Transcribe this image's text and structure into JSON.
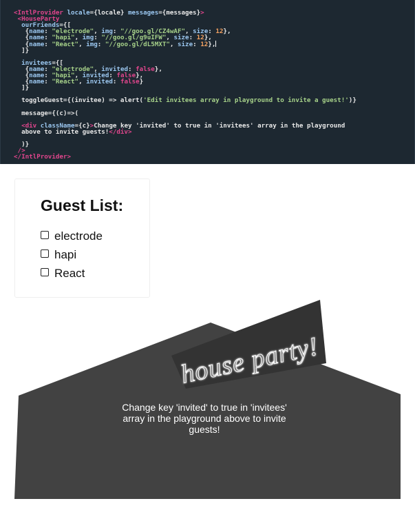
{
  "code_lines": [
    [
      [
        "tag",
        "<IntlProvider "
      ],
      [
        "attr",
        "locale"
      ],
      [
        "plain",
        "={locale} "
      ],
      [
        "attr",
        "messages"
      ],
      [
        "plain",
        "={messages}"
      ],
      [
        "tag",
        ">"
      ]
    ],
    [
      [
        "tag",
        " <HouseParty"
      ]
    ],
    [
      [
        "attr",
        "  ourFriends"
      ],
      [
        "plain",
        "={["
      ]
    ],
    [
      [
        "plain",
        "   {"
      ],
      [
        "attr",
        "name"
      ],
      [
        "plain",
        ": "
      ],
      [
        "str",
        "\"electrode\""
      ],
      [
        "plain",
        ", "
      ],
      [
        "attr",
        "img"
      ],
      [
        "plain",
        ": "
      ],
      [
        "str",
        "\"//goo.gl/CZ4wAF\""
      ],
      [
        "plain",
        ", "
      ],
      [
        "attr",
        "size"
      ],
      [
        "plain",
        ": "
      ],
      [
        "num",
        "12"
      ],
      [
        "plain",
        "},"
      ]
    ],
    [
      [
        "plain",
        "   {"
      ],
      [
        "attr",
        "name"
      ],
      [
        "plain",
        ": "
      ],
      [
        "str",
        "\"hapi\""
      ],
      [
        "plain",
        ", "
      ],
      [
        "attr",
        "img"
      ],
      [
        "plain",
        ": "
      ],
      [
        "str",
        "\"//goo.gl/g9uIFW\""
      ],
      [
        "plain",
        ", "
      ],
      [
        "attr",
        "size"
      ],
      [
        "plain",
        ": "
      ],
      [
        "num",
        "12"
      ],
      [
        "plain",
        "},"
      ]
    ],
    [
      [
        "plain",
        "   {"
      ],
      [
        "attr",
        "name"
      ],
      [
        "plain",
        ": "
      ],
      [
        "str",
        "\"React\""
      ],
      [
        "plain",
        ", "
      ],
      [
        "attr",
        "img"
      ],
      [
        "plain",
        ": "
      ],
      [
        "str",
        "\"//goo.gl/dL5MXT\""
      ],
      [
        "plain",
        ", "
      ],
      [
        "attr",
        "size"
      ],
      [
        "plain",
        ": "
      ],
      [
        "num",
        "12"
      ],
      [
        "plain",
        "},"
      ],
      [
        "cursor",
        ""
      ]
    ],
    [
      [
        "plain",
        "  ]}"
      ]
    ],
    [
      [
        "plain",
        ""
      ]
    ],
    [
      [
        "attr",
        "  invitees"
      ],
      [
        "plain",
        "={["
      ]
    ],
    [
      [
        "plain",
        "   {"
      ],
      [
        "attr",
        "name"
      ],
      [
        "plain",
        ": "
      ],
      [
        "str",
        "\"electrode\""
      ],
      [
        "plain",
        ", "
      ],
      [
        "attr",
        "invited"
      ],
      [
        "plain",
        ": "
      ],
      [
        "kw",
        "false"
      ],
      [
        "plain",
        "},"
      ]
    ],
    [
      [
        "plain",
        "   {"
      ],
      [
        "attr",
        "name"
      ],
      [
        "plain",
        ": "
      ],
      [
        "str",
        "\"hapi\""
      ],
      [
        "plain",
        ", "
      ],
      [
        "attr",
        "invited"
      ],
      [
        "plain",
        ": "
      ],
      [
        "kw",
        "false"
      ],
      [
        "plain",
        "},"
      ]
    ],
    [
      [
        "plain",
        "   {"
      ],
      [
        "attr",
        "name"
      ],
      [
        "plain",
        ": "
      ],
      [
        "str",
        "\"React\""
      ],
      [
        "plain",
        ", "
      ],
      [
        "attr",
        "invited"
      ],
      [
        "plain",
        ": "
      ],
      [
        "kw",
        "false"
      ],
      [
        "plain",
        "}"
      ]
    ],
    [
      [
        "plain",
        "  ]}"
      ]
    ],
    [
      [
        "plain",
        ""
      ]
    ],
    [
      [
        "plain",
        "  toggleGuest={(invitee) => alert("
      ],
      [
        "str",
        "'Edit invitees array in playground to invite a guest!'"
      ],
      [
        "plain",
        ")}"
      ]
    ],
    [
      [
        "plain",
        ""
      ]
    ],
    [
      [
        "plain",
        "  message={(c)=>("
      ]
    ],
    [
      [
        "plain",
        ""
      ]
    ],
    [
      [
        "tag",
        "  <div "
      ],
      [
        "attr",
        "className"
      ],
      [
        "plain",
        "={c}"
      ],
      [
        "tag",
        ">"
      ],
      [
        "plain",
        "Change key 'invited' to true in 'invitees' array in the playground"
      ]
    ],
    [
      [
        "plain",
        "  above to invite guests!"
      ],
      [
        "tag",
        "</div>"
      ]
    ],
    [
      [
        "plain",
        ""
      ]
    ],
    [
      [
        "plain",
        "  )}"
      ]
    ],
    [
      [
        "tag",
        " />"
      ]
    ],
    [
      [
        "tag",
        "</IntlProvider>"
      ]
    ]
  ],
  "guest_list": {
    "title": "Guest List:",
    "guests": [
      {
        "name": "electrode",
        "checked": false
      },
      {
        "name": "hapi",
        "checked": false
      },
      {
        "name": "React",
        "checked": false
      }
    ]
  },
  "house": {
    "sign_text": "house party!",
    "message": "Change key 'invited' to true in 'invitees' array in the playground above to invite guests!",
    "colors": {
      "roof": "#424242",
      "sign": "#333333",
      "neon": "#ffffff"
    }
  },
  "colors": {
    "editor_bg": "#1d2831",
    "tag": "#e0458c",
    "attr": "#9bc7f0",
    "string": "#a6d189",
    "number": "#f3a262"
  }
}
